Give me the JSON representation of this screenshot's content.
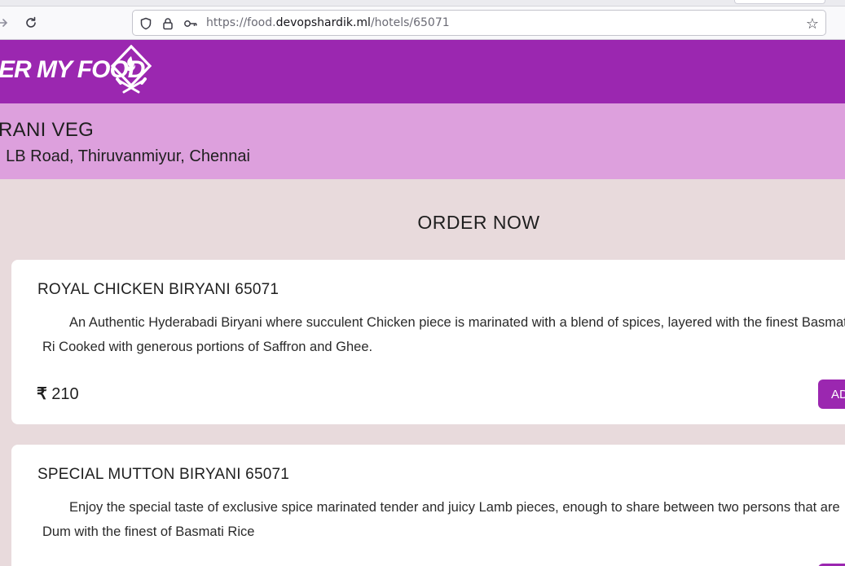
{
  "browser": {
    "url_prefix": "https://food.",
    "url_host": "devopshardik.ml",
    "url_path": "/hotels/65071",
    "icons": [
      "back-arrow-icon",
      "reload-icon",
      "shield-icon",
      "lock-icon",
      "key-icon",
      "bookmark-star-icon"
    ]
  },
  "header": {
    "brand": "ER MY FOOD",
    "logo_icon": "chef-knives-logo-icon",
    "bg_color": "#9b27b0"
  },
  "hotel": {
    "name": "RANI VEG",
    "address": ", LB Road, Thiruvanmiyur, Chennai",
    "band_color": "#dda0dd"
  },
  "order_heading": "ORDER NOW",
  "items": [
    {
      "name": "ROYAL CHICKEN BIRYANI 65071",
      "description": "An Authentic Hyderabadi Biryani where succulent Chicken piece is marinated with a blend of spices, layered with the finest Basmati Ri Cooked with generous portions of Saffron and Ghee.",
      "currency": "₹",
      "price": "210",
      "add_label": "AD"
    },
    {
      "name": "SPECIAL MUTTON BIRYANI 65071",
      "description": "Enjoy the special taste of exclusive spice marinated tender and juicy Lamb pieces, enough to share between two persons that are Dum with the finest of Basmati Rice"
    }
  ]
}
